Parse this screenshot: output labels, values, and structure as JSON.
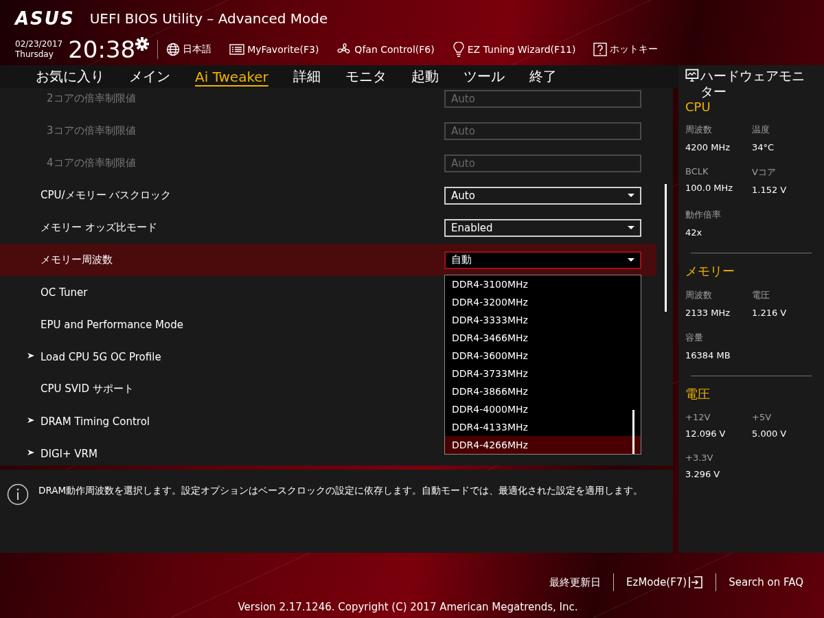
{
  "header": {
    "logo": "ASUS",
    "title": "UEFI BIOS Utility – Advanced Mode",
    "date": "02/23/2017",
    "weekday": "Thursday",
    "time": "20:38",
    "tools": [
      {
        "kind": "globe",
        "label": "日本語"
      },
      {
        "kind": "list",
        "label": "MyFavorite(F3)"
      },
      {
        "kind": "fan",
        "label": "Qfan Control(F6)"
      },
      {
        "kind": "bulb",
        "label": "EZ Tuning Wizard(F11)"
      },
      {
        "kind": "help",
        "label": "ホットキー"
      }
    ]
  },
  "tabs": [
    {
      "label": "お気に入り",
      "selected": false
    },
    {
      "label": "メイン",
      "selected": false
    },
    {
      "label": "Ai Tweaker",
      "selected": true
    },
    {
      "label": "詳細",
      "selected": false
    },
    {
      "label": "モニタ",
      "selected": false
    },
    {
      "label": "起動",
      "selected": false
    },
    {
      "label": "ツール",
      "selected": false
    },
    {
      "label": "終了",
      "selected": false
    }
  ],
  "settings": [
    {
      "kind": "field",
      "label": "2コアの倍率制限値",
      "value": "Auto",
      "disabled": true,
      "selected": false
    },
    {
      "kind": "field",
      "label": "3コアの倍率制限値",
      "value": "Auto",
      "disabled": true,
      "selected": false
    },
    {
      "kind": "field",
      "label": "4コアの倍率制限値",
      "value": "Auto",
      "disabled": true,
      "selected": false
    },
    {
      "kind": "dropdown",
      "label": "CPU/メモリー バスクロック",
      "value": "Auto",
      "disabled": false,
      "selected": false
    },
    {
      "kind": "dropdown",
      "label": "メモリー オッズ比モード",
      "value": "Enabled",
      "disabled": false,
      "selected": false
    },
    {
      "kind": "dropdown",
      "label": "メモリー周波数",
      "value": "自動",
      "disabled": false,
      "selected": true,
      "expanded": true
    },
    {
      "kind": "plain",
      "label": "OC Tuner",
      "disabled": false,
      "selected": false
    },
    {
      "kind": "plain",
      "label": "EPU and Performance Mode",
      "disabled": false,
      "selected": false
    },
    {
      "kind": "submenu",
      "label": "Load CPU 5G OC Profile",
      "disabled": false,
      "selected": false
    },
    {
      "kind": "plain",
      "label": "CPU SVID サポート",
      "disabled": false,
      "selected": false
    },
    {
      "kind": "submenu",
      "label": "DRAM Timing Control",
      "disabled": false,
      "selected": false
    },
    {
      "kind": "submenu",
      "label": "DIGI+ VRM",
      "disabled": false,
      "selected": false
    }
  ],
  "dropdown_options": [
    {
      "label": "DDR4-3100MHz",
      "selected": false
    },
    {
      "label": "DDR4-3200MHz",
      "selected": false
    },
    {
      "label": "DDR4-3333MHz",
      "selected": false
    },
    {
      "label": "DDR4-3466MHz",
      "selected": false
    },
    {
      "label": "DDR4-3600MHz",
      "selected": false
    },
    {
      "label": "DDR4-3733MHz",
      "selected": false
    },
    {
      "label": "DDR4-3866MHz",
      "selected": false
    },
    {
      "label": "DDR4-4000MHz",
      "selected": false
    },
    {
      "label": "DDR4-4133MHz",
      "selected": false
    },
    {
      "label": "DDR4-4266MHz",
      "selected": true
    }
  ],
  "help_text": "DRAM動作周波数を選択します。設定オプションはベースクロックの設定に依存します。自動モードでは、最適化された設定を適用します。",
  "monitor": {
    "title": "ハードウェアモニター",
    "sections": [
      {
        "heading": "CPU",
        "items": [
          {
            "label": "周波数",
            "value": "4200 MHz"
          },
          {
            "label": "温度",
            "value": "34°C"
          },
          {
            "label": "BCLK",
            "value": "100.0 MHz"
          },
          {
            "label": "Vコア",
            "value": "1.152 V"
          },
          {
            "label": "動作倍率",
            "value": "42x"
          }
        ]
      },
      {
        "heading": "メモリー",
        "items": [
          {
            "label": "周波数",
            "value": "2133 MHz"
          },
          {
            "label": "電圧",
            "value": "1.216 V"
          },
          {
            "label": "容量",
            "value": "16384 MB"
          }
        ]
      },
      {
        "heading": "電圧",
        "items": [
          {
            "label": "+12V",
            "value": "12.096 V"
          },
          {
            "label": "+5V",
            "value": "5.000 V"
          },
          {
            "label": "+3.3V",
            "value": "3.296 V"
          }
        ]
      }
    ]
  },
  "footer": {
    "links": [
      {
        "kind": "text",
        "label": "最終更新日"
      },
      {
        "kind": "exit",
        "label": "EzMode(F7)"
      },
      {
        "kind": "text",
        "label": "Search on FAQ"
      }
    ],
    "version": "Version 2.17.1246. Copyright (C) 2017 American Megatrends, Inc."
  }
}
